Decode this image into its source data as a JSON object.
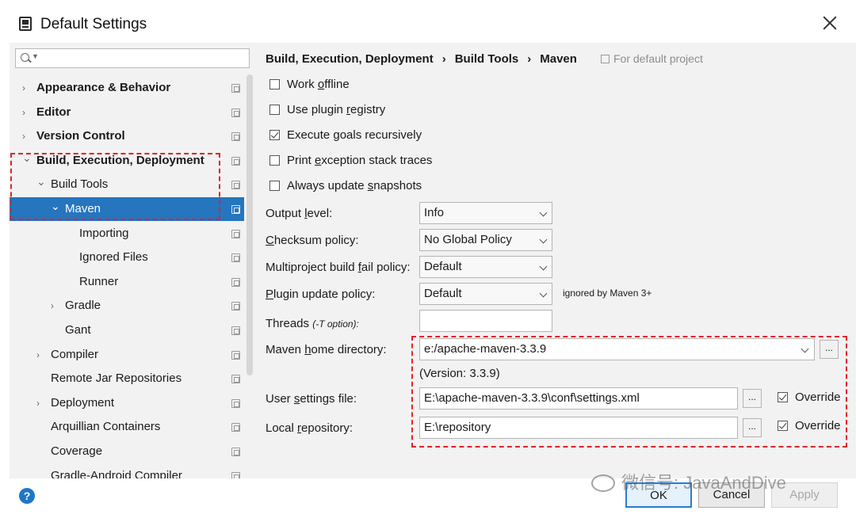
{
  "window": {
    "title": "Default Settings"
  },
  "search": {
    "placeholder": ""
  },
  "tree": [
    {
      "label": "Appearance & Behavior",
      "arrow": ">",
      "bold": true
    },
    {
      "label": "Editor",
      "arrow": ">",
      "bold": true
    },
    {
      "label": "Version Control",
      "arrow": ">",
      "bold": true
    },
    {
      "label": "Build, Execution, Deployment",
      "arrow": "v",
      "bold": true
    },
    {
      "label": "Build Tools",
      "arrow": "v"
    },
    {
      "label": "Maven",
      "arrow": "v",
      "selected": true
    },
    {
      "label": "Importing"
    },
    {
      "label": "Ignored Files"
    },
    {
      "label": "Runner"
    },
    {
      "label": "Gradle",
      "arrow": ">"
    },
    {
      "label": "Gant"
    },
    {
      "label": "Compiler",
      "arrow": ">"
    },
    {
      "label": "Remote Jar Repositories"
    },
    {
      "label": "Deployment",
      "arrow": ">"
    },
    {
      "label": "Arquillian Containers"
    },
    {
      "label": "Coverage"
    },
    {
      "label": "Gradle-Android Compiler"
    }
  ],
  "breadcrumb": {
    "items": [
      "Build, Execution, Deployment",
      "Build Tools",
      "Maven"
    ],
    "separator": "›",
    "note": "For default project"
  },
  "options": [
    {
      "label": "Work offline",
      "checked": false
    },
    {
      "label": "Use plugin registry",
      "checked": false
    },
    {
      "label": "Execute goals recursively",
      "checked": true
    },
    {
      "label": "Print exception stack traces",
      "checked": false
    },
    {
      "label": "Always update snapshots",
      "checked": false
    }
  ],
  "fields": {
    "output_level": {
      "label": "Output level:",
      "value": "Info"
    },
    "checksum_policy": {
      "label": "Checksum policy:",
      "value": "No Global Policy"
    },
    "multiproject_policy": {
      "label": "Multiproject build fail policy:",
      "value": "Default"
    },
    "plugin_update_policy": {
      "label": "Plugin update policy:",
      "value": "Default",
      "note": "ignored by Maven 3+"
    },
    "threads": {
      "label": "Threads",
      "hint": "(-T option):",
      "value": ""
    },
    "maven_home": {
      "label": "Maven home directory:",
      "value": "e:/apache-maven-3.3.9",
      "version": "(Version: 3.3.9)"
    },
    "user_settings": {
      "label": "User settings file:",
      "value": "E:\\apache-maven-3.3.9\\conf\\settings.xml",
      "override_label": "Override",
      "override_checked": true
    },
    "local_repo": {
      "label": "Local repository:",
      "value": "E:\\repository",
      "override_label": "Override",
      "override_checked": true
    },
    "browse_label": "..."
  },
  "buttons": {
    "help": "?",
    "ok": "OK",
    "cancel": "Cancel",
    "apply": "Apply"
  },
  "watermark": "微信号: JavaAndDive",
  "colors": {
    "selection": "#2675bf",
    "highlight_box": "#e0242b",
    "help": "#1e76c8"
  }
}
